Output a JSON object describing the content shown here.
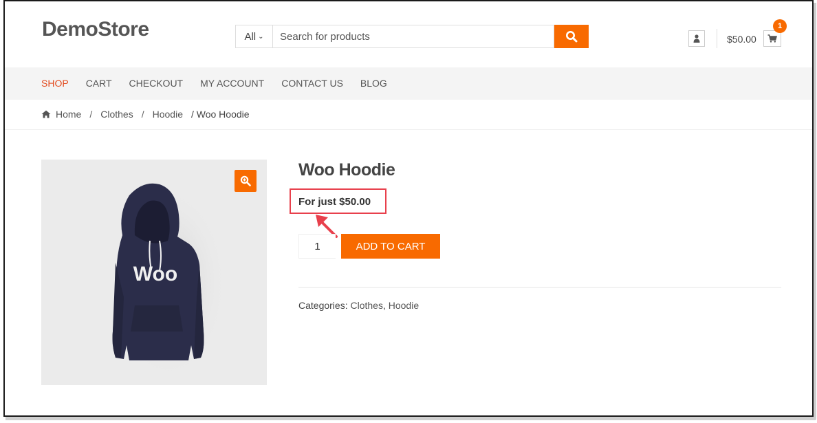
{
  "header": {
    "logo": "DemoStore",
    "search": {
      "category": "All",
      "placeholder": "Search for products",
      "icon": "search-icon"
    },
    "account_icon": "user-icon",
    "cart": {
      "total": "$50.00",
      "count": "1",
      "icon": "cart-icon"
    }
  },
  "nav": {
    "items": [
      "SHOP",
      "CART",
      "CHECKOUT",
      "MY ACCOUNT",
      "CONTACT US",
      "BLOG"
    ],
    "active": "SHOP"
  },
  "breadcrumb": {
    "home_icon": "home-icon",
    "items": [
      "Home",
      "Clothes",
      "Hoodie"
    ],
    "current": "/ Woo Hoodie"
  },
  "product": {
    "title": "Woo Hoodie",
    "price_text": "For just $50.00",
    "quantity": "1",
    "add_to_cart": "ADD TO CART",
    "hoodie_print": "Woo",
    "categories_label": "Categories:",
    "categories": [
      "Clothes",
      "Hoodie"
    ],
    "zoom_icon": "zoom-in-icon"
  },
  "colors": {
    "accent": "#f86a00",
    "nav_active": "#e24a1e",
    "highlight_box": "#e8404c",
    "hoodie": "#2b2d4a"
  }
}
